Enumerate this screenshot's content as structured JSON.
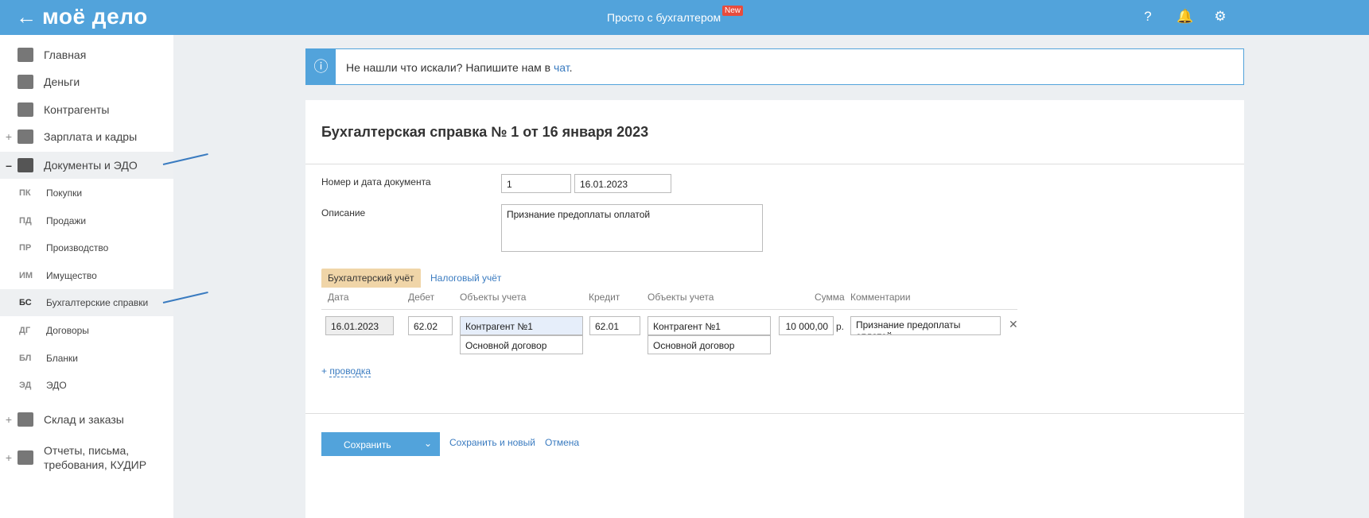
{
  "header": {
    "logo": "моё дело",
    "center": "Просто с бухгалтером",
    "badge": "New"
  },
  "sidebar": {
    "items": [
      {
        "label": "Главная",
        "pm": ""
      },
      {
        "label": "Деньги",
        "pm": ""
      },
      {
        "label": "Контрагенты",
        "pm": ""
      },
      {
        "label": "Зарплата и кадры",
        "pm": "+"
      },
      {
        "label": "Документы и ЭДО",
        "pm": "–"
      }
    ],
    "sub": [
      {
        "ab": "ПК",
        "label": "Покупки"
      },
      {
        "ab": "ПД",
        "label": "Продажи"
      },
      {
        "ab": "ПР",
        "label": "Производство"
      },
      {
        "ab": "ИМ",
        "label": "Имущество"
      },
      {
        "ab": "БС",
        "label": "Бухгалтерские справки"
      },
      {
        "ab": "ДГ",
        "label": "Договоры"
      },
      {
        "ab": "БЛ",
        "label": "Бланки"
      },
      {
        "ab": "ЭД",
        "label": "ЭДО"
      }
    ],
    "bottom": [
      {
        "label": "Склад и заказы",
        "pm": "+"
      },
      {
        "label": "Отчеты, письма, требования, КУДИР",
        "pm": "+"
      }
    ]
  },
  "info": {
    "text": "Не нашли что искали? Напишите нам в ",
    "link": "чат",
    "end": "."
  },
  "form": {
    "title": "Бухгалтерская справка № 1 от 16 января 2023",
    "num_label": "Номер и дата документа",
    "num": "1",
    "date": "16.01.2023",
    "desc_label": "Описание",
    "desc": "Признание предоплаты оплатой",
    "tabs": [
      "Бухгалтерский учёт",
      "Налоговый учёт"
    ],
    "columns": [
      "Дата",
      "Дебет",
      "Объекты учета",
      "Кредит",
      "Объекты учета",
      "Сумма",
      "Комментарии"
    ],
    "row": {
      "date": "16.01.2023",
      "debit": "62.02",
      "debit_obj1": "Контрагент №1",
      "debit_obj2": "Основной договор",
      "credit": "62.01",
      "credit_obj1": "Контрагент №1",
      "credit_obj2": "Основной договор",
      "sum": "10 000,00",
      "cur": "р.",
      "comment": "Признание предоплаты оплатой"
    },
    "add": "проводка",
    "save": "Сохранить",
    "save_new": "Сохранить и новый",
    "cancel": "Отмена"
  }
}
